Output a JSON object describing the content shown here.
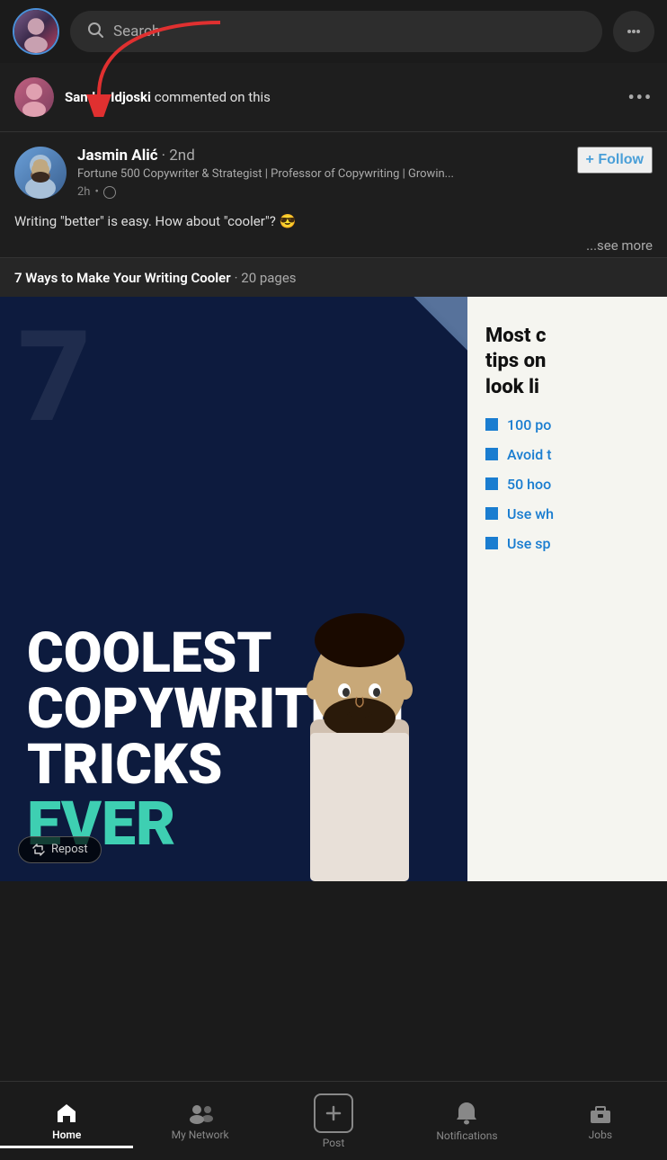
{
  "topNav": {
    "searchPlaceholder": "Search",
    "messagingIcon": "messaging-icon"
  },
  "notification": {
    "commenterName": "Sandra Idjoski",
    "action": "commented on this",
    "moreLabel": "•••"
  },
  "post": {
    "authorName": "Jasmin Alić",
    "authorDegree": "· 2nd",
    "authorTitle": "Fortune 500 Copywriter & Strategist | Professor of Copywriting | Growin...",
    "postTime": "2h",
    "followLabel": "+ Follow",
    "bodyText": "Writing \"better\" is easy. How about \"cooler\"? 😎",
    "seeMoreLabel": "...see more",
    "docTitle": "7 Ways to Make Your Writing Cooler",
    "docPages": "· 20 pages",
    "page1": {
      "number": "7",
      "line1": "COOLEST",
      "line2": "COPYWRITING",
      "line3": "TRICKS",
      "line4": "EVER",
      "repostLabel": "Repost"
    },
    "page2": {
      "title": "Most c tips on look li",
      "items": [
        "100 po",
        "Avoid t",
        "50 hoo",
        "Use wh",
        "Use sp"
      ]
    }
  },
  "bottomNav": {
    "items": [
      {
        "id": "home",
        "icon": "home-icon",
        "label": "Home",
        "active": true
      },
      {
        "id": "my-network",
        "icon": "network-icon",
        "label": "My Network",
        "active": false
      },
      {
        "id": "post",
        "icon": "post-icon",
        "label": "Post",
        "active": false
      },
      {
        "id": "notifications",
        "icon": "notifications-icon",
        "label": "Notifications",
        "active": false
      },
      {
        "id": "jobs",
        "icon": "jobs-icon",
        "label": "Jobs",
        "active": false
      }
    ]
  }
}
